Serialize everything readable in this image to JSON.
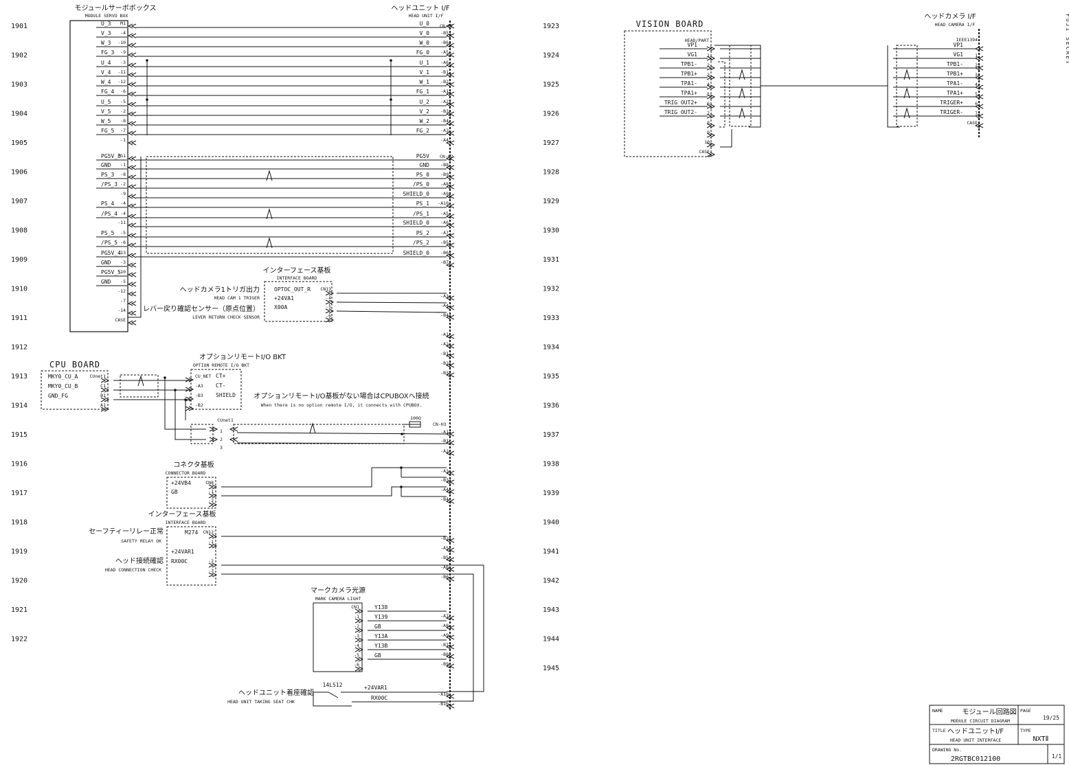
{
  "header": {
    "secret": "FUJI SECRET"
  },
  "left_rows": [
    "1901",
    "1902",
    "1903",
    "1904",
    "1905",
    "1906",
    "1907",
    "1908",
    "1909",
    "1910",
    "1911",
    "1912",
    "1913",
    "1914",
    "1915",
    "1916",
    "1917",
    "1918",
    "1919",
    "1920",
    "1921",
    "1922"
  ],
  "mid_rows": [
    "1923",
    "1924",
    "1925",
    "1926",
    "1927",
    "1928",
    "1929",
    "1930",
    "1931",
    "1932",
    "1933",
    "1934",
    "1935",
    "1936",
    "1937",
    "1938",
    "1939",
    "1940",
    "1941",
    "1942",
    "1943",
    "1944",
    "1945"
  ],
  "servo_box": {
    "title_jp": "モジュールサーボボックス",
    "title_en": "MODULE SERVO BOX",
    "signals": [
      {
        "name": "U_3",
        "pin": "M1"
      },
      {
        "name": "V_3",
        "pin": "-4"
      },
      {
        "name": "W_3",
        "pin": "-10"
      },
      {
        "name": "FG_3",
        "pin": "-9"
      },
      {
        "name": "U_4",
        "pin": "-3"
      },
      {
        "name": "V_4",
        "pin": "-11"
      },
      {
        "name": "W_4",
        "pin": "-12"
      },
      {
        "name": "FG_4",
        "pin": "-6"
      },
      {
        "name": "U_5",
        "pin": "-5"
      },
      {
        "name": "V_5",
        "pin": "-2"
      },
      {
        "name": "W_5",
        "pin": "-8"
      },
      {
        "name": "FG_5",
        "pin": "-7"
      },
      {
        "name": "",
        "pin": "-1"
      },
      {
        "name": "PG5V_3",
        "pin": "PG1"
      },
      {
        "name": "GND",
        "pin": "-1"
      },
      {
        "name": "PS_3",
        "pin": "-8"
      },
      {
        "name": "/PS_3",
        "pin": "-2"
      },
      {
        "name": "",
        "pin": "-9"
      },
      {
        "name": "PS_4",
        "pin": "-4"
      },
      {
        "name": "/PS_4",
        "pin": "-4"
      },
      {
        "name": "",
        "pin": "-11"
      },
      {
        "name": "PS_5",
        "pin": "-5"
      },
      {
        "name": "/PS_5",
        "pin": "-6"
      },
      {
        "name": "PG5V_4",
        "pin": "-13"
      },
      {
        "name": "GND",
        "pin": "-3"
      },
      {
        "name": "PG5V_5",
        "pin": "-10"
      },
      {
        "name": "GND",
        "pin": "-5"
      },
      {
        "name": "",
        "pin": "-12"
      },
      {
        "name": "",
        "pin": "-7"
      },
      {
        "name": "",
        "pin": "-14"
      },
      {
        "name": "",
        "pin": "CASE"
      }
    ]
  },
  "head_unit": {
    "title_jp": "ヘッドユニット I/F",
    "title_en": "HEAD UNIT I/F",
    "cn_h1": "CN-H1",
    "cn_h2": "CN-H2",
    "cn_h3": "CN-H3",
    "signals": [
      {
        "name": "U_0",
        "pin": "-"
      },
      {
        "name": "V_0",
        "pin": "-B5"
      },
      {
        "name": "W_0",
        "pin": "-B6"
      },
      {
        "name": "FG_0",
        "pin": "-A5"
      },
      {
        "name": "U_1",
        "pin": "-A6"
      },
      {
        "name": "V_1",
        "pin": "-B1"
      },
      {
        "name": "W_1",
        "pin": "-B2"
      },
      {
        "name": "FG_1",
        "pin": "-A1"
      },
      {
        "name": "U_2",
        "pin": "-A2"
      },
      {
        "name": "V_2",
        "pin": "-B3"
      },
      {
        "name": "W_2",
        "pin": "-B4"
      },
      {
        "name": "FG_2",
        "pin": "-A3"
      },
      {
        "name": "",
        "pin": "-A4"
      },
      {
        "name": "PG5V",
        "pin": "-"
      },
      {
        "name": "GND",
        "pin": "-B8"
      },
      {
        "name": "PS_0",
        "pin": "-B9"
      },
      {
        "name": "/PS_0",
        "pin": "-A8"
      },
      {
        "name": "SHIELD_0",
        "pin": "-A9"
      },
      {
        "name": "PS_1",
        "pin": "-A10"
      },
      {
        "name": "/PS_1",
        "pin": "-A5"
      },
      {
        "name": "SHIELD_0",
        "pin": "-A6"
      },
      {
        "name": "PS_2",
        "pin": "-A7"
      },
      {
        "name": "/PS_2",
        "pin": "-B5"
      },
      {
        "name": "SHIELD_0",
        "pin": "-B6"
      },
      {
        "name": "",
        "pin": "-B7"
      }
    ],
    "right_pins": [
      "-A3",
      "-A4",
      "-B4",
      "-A1",
      "-A2",
      "-B1",
      "-B2",
      "-B3",
      "-A1",
      "-B1",
      "-A2",
      "-A3",
      "-B3",
      "-A4",
      "-B4",
      "-B2",
      "-A5",
      "-B5",
      "-A6",
      "-B6",
      "-A7",
      "-A8",
      "-A9",
      "-B7",
      "-B8",
      "-B9",
      "-A10",
      "-B10"
    ]
  },
  "interface_board_1": {
    "title_jp": "インターフェース基板",
    "title_en": "INTERFACE BOARD",
    "cn": "CN13",
    "rows": [
      {
        "name": "OPTOC_OUT_R",
        "pin": "CN13"
      },
      {
        "name": "+24VA1",
        "pin": "-4"
      },
      {
        "name": "X00A",
        "pin": "-5"
      },
      {
        "name": "",
        "pin": "-6"
      }
    ],
    "labels": [
      {
        "jp": "ヘッドカメラ1トリガ出力",
        "en": "HEAD CAM 1 TRIGER"
      },
      {
        "jp": "レバー戻り確認センサー（原点位置）",
        "en": "LEVER RETURN CHECK SENSOR"
      }
    ]
  },
  "cpu_board": {
    "title": "CPU BOARD",
    "rows": [
      {
        "name": "MKY0_CU_A",
        "pin": "CUnet1"
      },
      {
        "name": "MKY0_CU_B",
        "pin": "C1"
      },
      {
        "name": "GND_FG",
        "pin": "B1"
      },
      {
        "name": "",
        "pin": "A1"
      }
    ]
  },
  "option_bkt": {
    "title_jp": "オプションリモートI/O BKT",
    "title_en": "OPTION REMOTE I/O BKT",
    "rows": [
      {
        "name": "CU_NET",
        "pin": "CT+"
      },
      {
        "name": "-A3",
        "pin": "CT-"
      },
      {
        "name": "-B3",
        "pin": "SHIELD"
      },
      {
        "name": "-B2",
        "pin": ""
      }
    ]
  },
  "note": {
    "jp": "オプションリモートI/O基板がない場合はCPUBOXへ接続",
    "en": "When there is no option remote I/O, it connects with CPUBOX."
  },
  "cunet": {
    "label": "CUnet1",
    "pins": [
      "1",
      "2",
      "3"
    ],
    "resistor": "100Ω"
  },
  "connector_board": {
    "title_jp": "コネクタ基板",
    "title_en": "CONNECTOR BOARD",
    "cn": "CN8",
    "rows": [
      {
        "name": "+24VB4",
        "pin": "CN8"
      },
      {
        "name": "GB",
        "pin": "-1"
      },
      {
        "name": "",
        "pin": "-2"
      }
    ]
  },
  "interface_board_2": {
    "title_jp": "インターフェース基板",
    "title_en": "INTERFACE BOARD",
    "cn": "CN12",
    "rows": [
      {
        "name": "M274",
        "pin": "CN12"
      },
      {
        "name": "",
        "pin": "-1"
      },
      {
        "name": "+24VAR1",
        "pin": ""
      },
      {
        "name": "RX00C",
        "pin": "-2"
      },
      {
        "name": "",
        "pin": "-3"
      }
    ],
    "labels": [
      {
        "jp": "セーフティーリレー正常",
        "en": "SAFETY RELAY OK"
      },
      {
        "jp": "ヘッド接続確認",
        "en": "HEAD CONNECTION CHECK"
      }
    ]
  },
  "mark_camera": {
    "title_jp": "マークカメラ光源",
    "title_en": "MARK CAMERA LIGHT",
    "cn": "CN1",
    "rows": [
      {
        "name": "Y138",
        "pin": "CN1"
      },
      {
        "name": "Y139",
        "pin": "-1"
      },
      {
        "name": "GB",
        "pin": "-2"
      },
      {
        "name": "Y13A",
        "pin": "-3"
      },
      {
        "name": "Y13B",
        "pin": "-4"
      },
      {
        "name": "GB",
        "pin": "-5"
      },
      {
        "name": "",
        "pin": "-6"
      }
    ]
  },
  "head_seat": {
    "label_jp": "ヘッドユニット着座確認",
    "label_en": "HEAD UNIT TAKING SEAT CHK",
    "switch": "14LS12",
    "rows": [
      "+24VAR1",
      "RX00C"
    ]
  },
  "vision_board": {
    "title": "VISION BOARD",
    "header": "HEAD/PART",
    "rows": [
      {
        "name": "VP1",
        "pin": ""
      },
      {
        "name": "VG1",
        "pin": "1"
      },
      {
        "name": "TPB1-",
        "pin": "2"
      },
      {
        "name": "TPB1+",
        "pin": "3"
      },
      {
        "name": "TPA1-",
        "pin": "4"
      },
      {
        "name": "TPA1+",
        "pin": "5"
      },
      {
        "name": "TRIG OUT2+",
        "pin": "6"
      },
      {
        "name": "TRIG OUT2-",
        "pin": "7"
      },
      {
        "name": "",
        "pin": "8"
      },
      {
        "name": "",
        "pin": "9"
      },
      {
        "name": "",
        "pin": "10"
      },
      {
        "name": "",
        "pin": "CASE"
      }
    ]
  },
  "head_camera": {
    "title_jp": "ヘッドカメラ I/F",
    "title_en": "HEAD CAMERA I/F",
    "header": "IEEE1394",
    "rows": [
      {
        "name": "VP1",
        "pin": ""
      },
      {
        "name": "VG1",
        "pin": "1"
      },
      {
        "name": "TPB1-",
        "pin": "2"
      },
      {
        "name": "TPB1+",
        "pin": "3"
      },
      {
        "name": "TPA1-",
        "pin": "4"
      },
      {
        "name": "TPA1+",
        "pin": "5"
      },
      {
        "name": "TRIGER+",
        "pin": "6"
      },
      {
        "name": "TRIGER-",
        "pin": "7"
      },
      {
        "name": "",
        "pin": "CASE"
      }
    ]
  },
  "title_block": {
    "name_label": "NAME",
    "name_jp": "モジュール回路図",
    "name_en": "MODULE CIRCUIT DIAGRAM",
    "page_label": "PAGE",
    "page_value": "19/25",
    "title_label": "TITLE",
    "title_jp": "ヘッドユニットI/F",
    "title_en": "HEAD UNIT INTERFACE",
    "type_label": "TYPE",
    "type_value": "NXTⅡ",
    "drawing_label": "DRAWING No.",
    "drawing_value": "2RGTBC012100",
    "sheet": "1/1"
  }
}
